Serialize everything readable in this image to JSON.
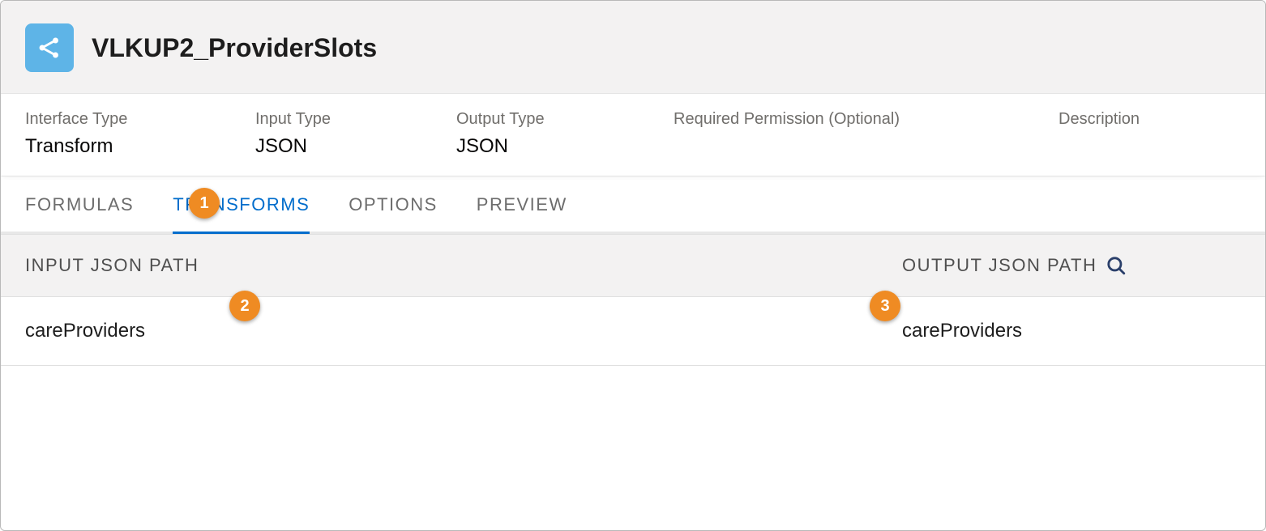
{
  "header": {
    "title": "VLKUP2_ProviderSlots"
  },
  "meta": {
    "interface_type_label": "Interface Type",
    "interface_type_value": "Transform",
    "input_type_label": "Input Type",
    "input_type_value": "JSON",
    "output_type_label": "Output Type",
    "output_type_value": "JSON",
    "required_permission_label": "Required Permission (Optional)",
    "description_label": "Description"
  },
  "tabs": {
    "formulas": "FORMULAS",
    "transforms": "TRANSFORMS",
    "options": "OPTIONS",
    "preview": "PREVIEW"
  },
  "section": {
    "input_json_path_label": "INPUT JSON PATH",
    "output_json_path_label": "OUTPUT JSON PATH",
    "input_value": "careProviders",
    "output_value": "careProviders"
  },
  "callouts": {
    "b1": "1",
    "b2": "2",
    "b3": "3"
  }
}
